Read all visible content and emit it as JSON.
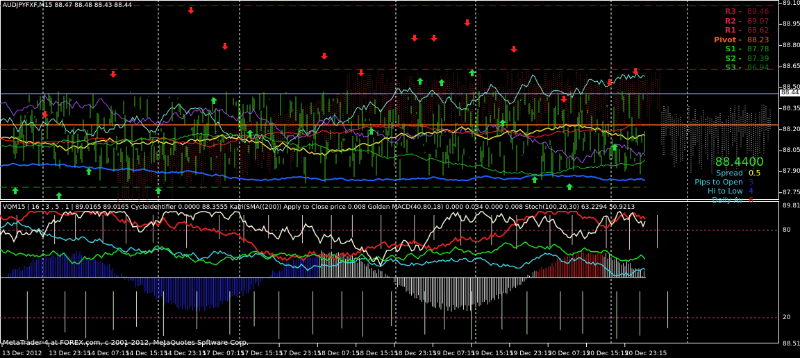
{
  "window": {
    "header": "AUDJPYFXF,M15  88.47 88.48 88.43 88.44",
    "indicator_header": "VQM15 | 16 , 3 , 5 , 1  |  89.0165 89.0165  CycleIdentifier 0.0000 88.3555  Kairi(SMA((200)) Apply to Close price 0.008  Golden MACD(40,80,18) 0.000 0.034 0.000 0.008  Stoch(100,20,30) 63.2294 50.9213",
    "copyright": "MetaTrader 4 at FOREX.com, c 2001-2012, MetaQuotes Software Corp."
  },
  "pivots": [
    {
      "label": "R3",
      "value": "89.46",
      "color": "#b0102a",
      "vcolor": "#8a1020"
    },
    {
      "label": "R2",
      "value": "89.07",
      "color": "#e0204a",
      "vcolor": "#a01830"
    },
    {
      "label": "R1",
      "value": "88.62",
      "color": "#e0204a",
      "vcolor": "#a01830"
    },
    {
      "label": "Pivot",
      "value": "88.23",
      "color": "#f06020",
      "vcolor": "#e06020"
    },
    {
      "label": "S1",
      "value": "87.78",
      "color": "#20c020",
      "vcolor": "#1a9a1a"
    },
    {
      "label": "S2",
      "value": "87.39",
      "color": "#20c020",
      "vcolor": "#1a8a1a"
    },
    {
      "label": "S3",
      "value": "86.94",
      "color": "#20a020",
      "vcolor": "#157015"
    }
  ],
  "pivot_separator": "-",
  "info": {
    "price": "88.4400",
    "rows": [
      {
        "label": "Spread",
        "value": "0.5",
        "vcolor": "#ffff40"
      },
      {
        "label": "Pips to Open",
        "value": "3",
        "vcolor": "#2020c0"
      },
      {
        "label": "Hi to Low",
        "value": "4",
        "vcolor": "#2040ff"
      },
      {
        "label": "Daily Av",
        "value": "6",
        "vcolor": "#e02020"
      }
    ]
  },
  "price_axis": [
    "89.10",
    "88.95",
    "88.80",
    "88.65",
    "88.50",
    "88.35",
    "88.20",
    "88.05",
    "87.90",
    "87.75"
  ],
  "current_price": "88.44",
  "sub_axis": {
    "top": "89.8152",
    "level80": "80",
    "level20": "20",
    "bottom": "88.5183"
  },
  "time_axis": [
    "13 Dec 2012",
    "13 Dec 23:15",
    "14 Dec 07:15",
    "14 Dec 15:15",
    "14 Dec 23:15",
    "17 Dec 07:15",
    "17 Dec 15:15",
    "17 Dec 23:15",
    "18 Dec 07:15",
    "18 Dec 15:15",
    "18 Dec 23:15",
    "19 Dec 07:15",
    "19 Dec 15:15",
    "19 Dec 23:15",
    "20 Dec 07:15",
    "20 Dec 15:15",
    "20 Dec 23:15"
  ]
}
